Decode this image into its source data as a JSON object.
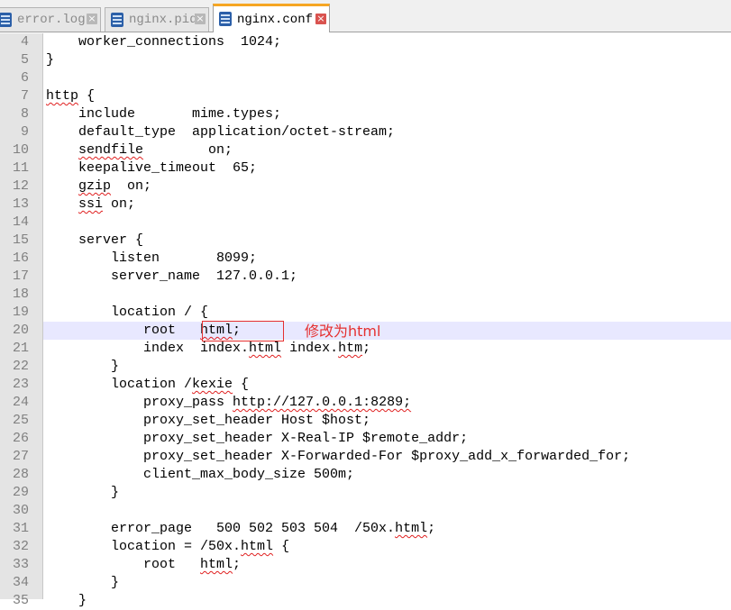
{
  "tabs": [
    {
      "label": "error.log",
      "active": false,
      "icon": "file-icon"
    },
    {
      "label": "nginx.pid",
      "active": false,
      "icon": "file-icon"
    },
    {
      "label": "nginx.conf",
      "active": true,
      "icon": "file-icon"
    }
  ],
  "editor": {
    "current_line": 20,
    "lines": [
      {
        "n": "4",
        "text": "    worker_connections  1024;"
      },
      {
        "n": "5",
        "text": "}"
      },
      {
        "n": "6",
        "text": ""
      },
      {
        "n": "7",
        "text": "http {"
      },
      {
        "n": "8",
        "text": "    include       mime.types;"
      },
      {
        "n": "9",
        "text": "    default_type  application/octet-stream;"
      },
      {
        "n": "10",
        "text": "    sendfile        on;"
      },
      {
        "n": "11",
        "text": "    keepalive_timeout  65;"
      },
      {
        "n": "12",
        "text": "    gzip  on;"
      },
      {
        "n": "13",
        "text": "    ssi on;"
      },
      {
        "n": "14",
        "text": ""
      },
      {
        "n": "15",
        "text": "    server {"
      },
      {
        "n": "16",
        "text": "        listen       8099;"
      },
      {
        "n": "17",
        "text": "        server_name  127.0.0.1;"
      },
      {
        "n": "18",
        "text": ""
      },
      {
        "n": "19",
        "text": "        location / {"
      },
      {
        "n": "20",
        "text": "            root   html;"
      },
      {
        "n": "21",
        "text": "            index  index.html index.htm;"
      },
      {
        "n": "22",
        "text": "        }"
      },
      {
        "n": "23",
        "text": "        location /kexie {"
      },
      {
        "n": "24",
        "text": "            proxy_pass http://127.0.0.1:8289;"
      },
      {
        "n": "25",
        "text": "            proxy_set_header Host $host;"
      },
      {
        "n": "26",
        "text": "            proxy_set_header X-Real-IP $remote_addr;"
      },
      {
        "n": "27",
        "text": "            proxy_set_header X-Forwarded-For $proxy_add_x_forwarded_for;"
      },
      {
        "n": "28",
        "text": "            client_max_body_size 500m;"
      },
      {
        "n": "29",
        "text": "        }"
      },
      {
        "n": "30",
        "text": ""
      },
      {
        "n": "31",
        "text": "        error_page   500 502 503 504  /50x.html;"
      },
      {
        "n": "32",
        "text": "        location = /50x.html {"
      },
      {
        "n": "33",
        "text": "            root   html;"
      },
      {
        "n": "34",
        "text": "        }"
      },
      {
        "n": "35",
        "text": "    }"
      }
    ]
  },
  "annotation": {
    "text": "修改为html",
    "color": "#e53030"
  },
  "colors": {
    "active_tab_accent": "#f6a623",
    "current_line_bg": "#e8e8ff",
    "spell_underline": "#e02020"
  }
}
